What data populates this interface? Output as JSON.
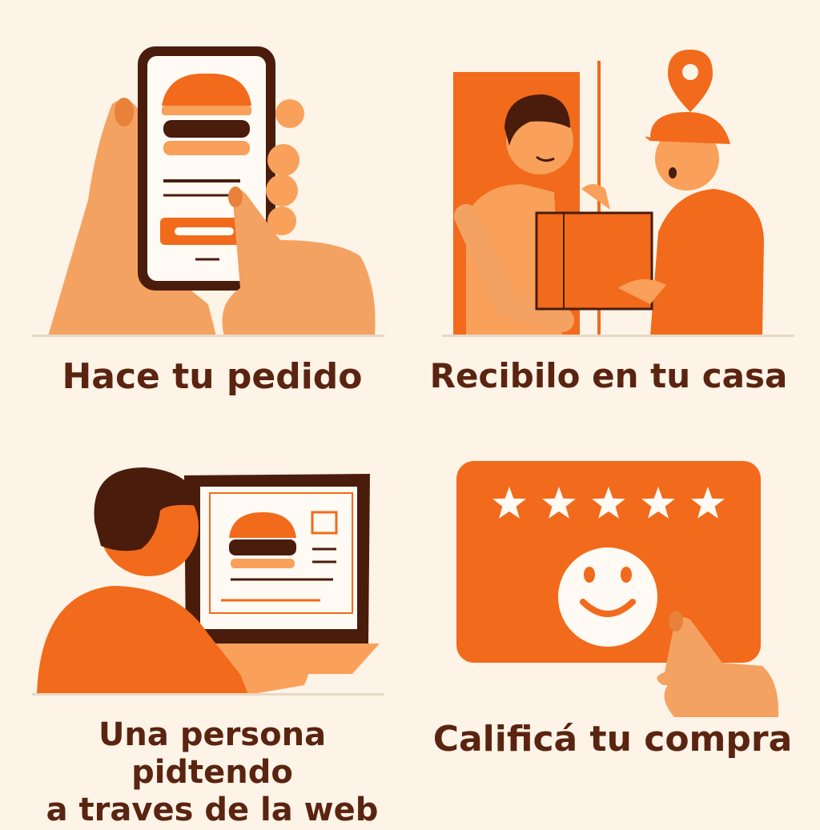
{
  "steps": [
    {
      "caption": [
        "Hace tu pedido"
      ],
      "illustration": "hand-holding-phone-burger-order"
    },
    {
      "caption": [
        "Recibilo en tu casa"
      ],
      "illustration": "courier-delivering-box-at-door"
    },
    {
      "caption": [
        "Una persona pidtendo",
        "a traves de la web"
      ],
      "illustration": "person-ordering-on-laptop"
    },
    {
      "caption": [
        "Calificá tu compra"
      ],
      "illustration": "rating-card-five-stars-smiley"
    }
  ],
  "rating": {
    "stars": 5
  },
  "colors": {
    "background": "#fdf3e7",
    "accent": "#f26a1b",
    "light": "#f9a05a",
    "dark": "#5a2410"
  }
}
